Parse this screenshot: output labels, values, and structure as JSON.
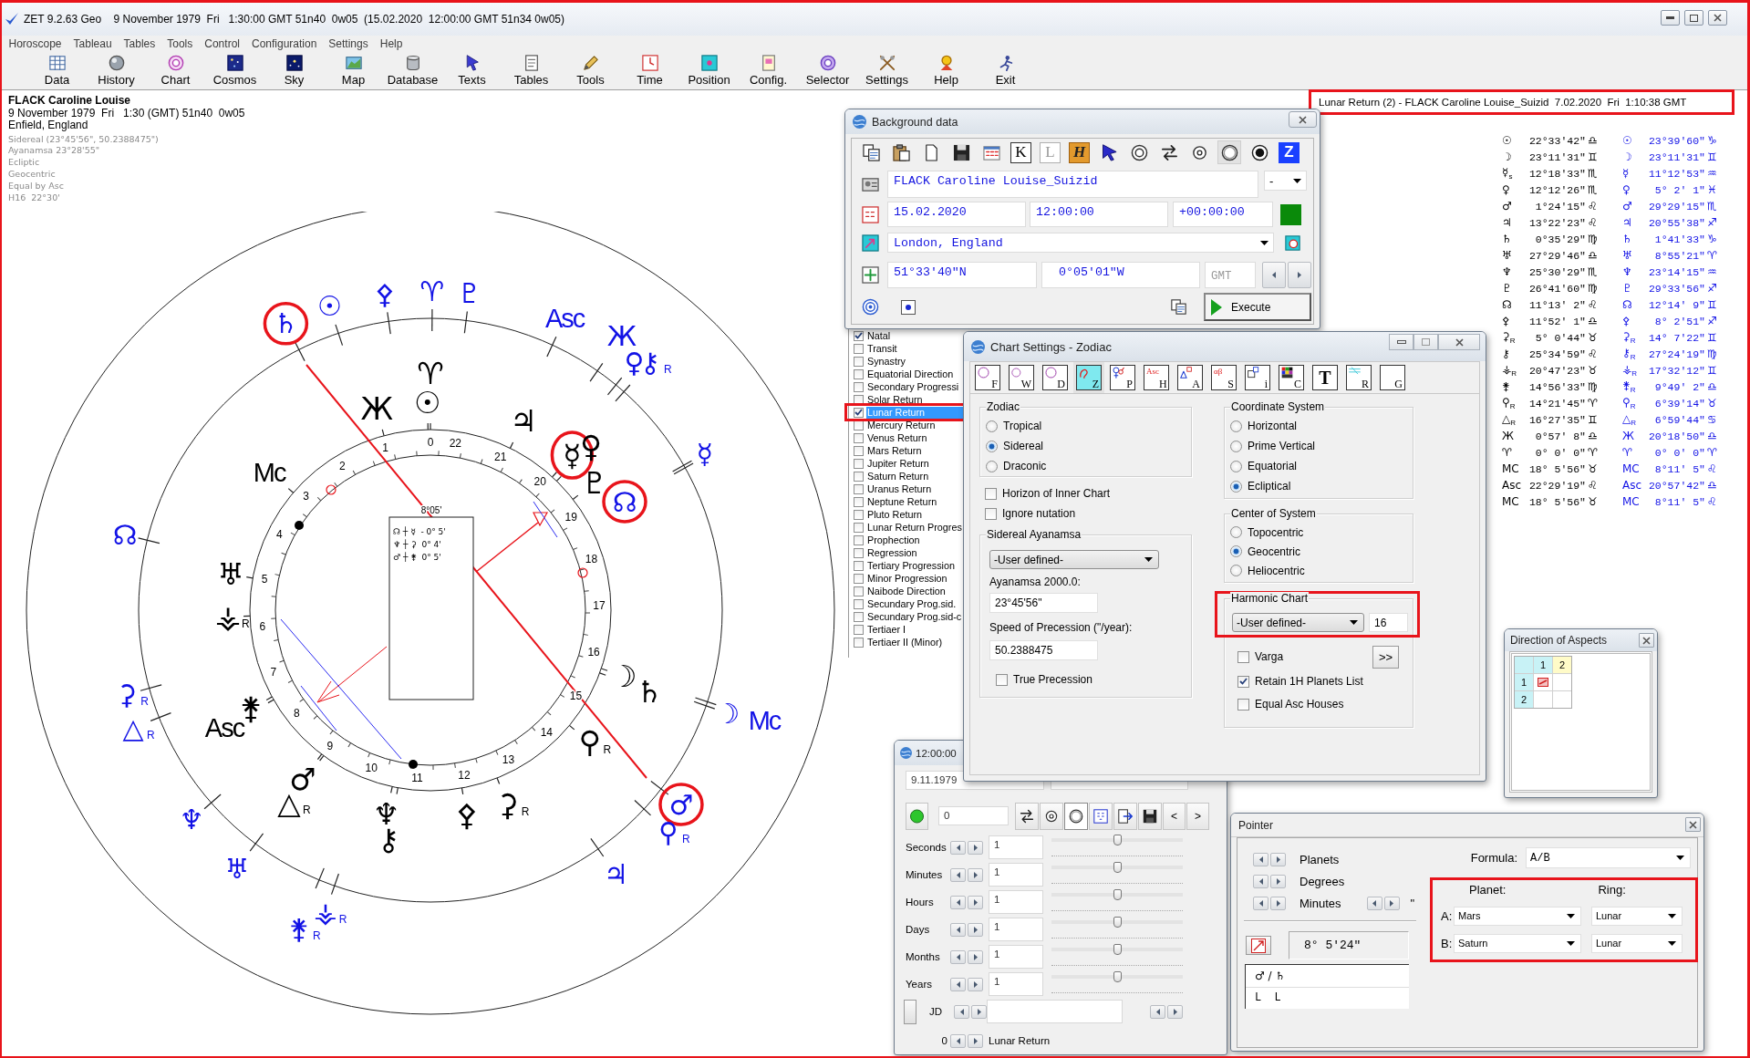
{
  "window": {
    "title": "ZET 9.2.63 Geo    9 November 1979  Fri   1:30:00 GMT 51n40  0w05  (15.02.2020  12:00:00 GMT 51n34 0w05)"
  },
  "menu": [
    "Horoscope",
    "Tableau",
    "Tables",
    "Tools",
    "Control",
    "Configuration",
    "Settings",
    "Help"
  ],
  "toolbar": [
    "Data",
    "History",
    "Chart",
    "Cosmos",
    "Sky",
    "Map",
    "Database",
    "Texts",
    "Tables",
    "Tools",
    "Time",
    "Position",
    "Config.",
    "Selector",
    "Settings",
    "Help",
    "Exit"
  ],
  "chart_header": {
    "name": "FLACK Caroline Louise",
    "lines": [
      "9 November 1979  Fri   1:30 (GMT) 51n40  0w05",
      "Enfield, England"
    ],
    "settings": [
      "Sidereal (23°45'56\", 50.2388475\")",
      "Ayanamsa 23°28'55\"",
      "Ecliptic",
      "Geocentric",
      "Equal by Asc",
      "H16  22°30'"
    ]
  },
  "return_header": {
    "text": "Lunar Return (2) - FLACK Caroline Louise_Suizid  7.02.2020  Fri  1:10:38 GMT",
    "annotated": true
  },
  "wheel": {
    "transit_symbols": [
      {
        "glyph": "♄",
        "kind": "planet",
        "circled": true
      },
      {
        "glyph": "☉",
        "kind": "planet",
        "circled": false
      },
      {
        "glyph": "⚴",
        "kind": "planet",
        "circled": false
      },
      {
        "glyph": "♈",
        "kind": "planet",
        "circled": false
      },
      {
        "glyph": "♇",
        "kind": "planet",
        "circled": false
      },
      {
        "glyph": "Asc",
        "kind": "angle",
        "circled": false
      },
      {
        "glyph": "Ж",
        "kind": "planet",
        "circled": false
      },
      {
        "glyph": "♀",
        "kind": "planet",
        "circled": false
      },
      {
        "glyph": "⚷",
        "kind": "planet",
        "circled": false,
        "retrograde_mark": "R"
      },
      {
        "glyph": "☿",
        "kind": "planet",
        "circled": false
      },
      {
        "glyph": "☊",
        "kind": "planet",
        "circled": true
      },
      {
        "glyph": "☊",
        "kind": "planet",
        "circled": false
      },
      {
        "glyph": "⚳",
        "kind": "planet",
        "circled": false,
        "retrograde_mark": "R"
      },
      {
        "glyph": "△",
        "kind": "planet",
        "circled": false,
        "retrograde_mark": "R"
      },
      {
        "glyph": "☽",
        "kind": "planet",
        "circled": false
      },
      {
        "glyph": "Mc",
        "kind": "angle",
        "circled": false
      },
      {
        "glyph": "♆",
        "kind": "planet",
        "circled": false
      },
      {
        "glyph": "♂",
        "kind": "planet",
        "circled": true
      },
      {
        "glyph": "⚲",
        "kind": "planet",
        "circled": false,
        "retrograde_mark": "R"
      },
      {
        "glyph": "♅",
        "kind": "planet",
        "circled": false
      },
      {
        "glyph": "♃",
        "kind": "planet",
        "circled": false
      },
      {
        "glyph": "⚶",
        "kind": "planet",
        "circled": false,
        "retrograde_mark": "R"
      },
      {
        "glyph": "⚵",
        "kind": "planet",
        "circled": false,
        "retrograde_mark": "R"
      }
    ],
    "natal_symbols": [
      {
        "glyph": "♈",
        "kind": "planet",
        "circled": false
      },
      {
        "glyph": "Ж",
        "kind": "planet",
        "circled": false
      },
      {
        "glyph": "☉",
        "kind": "planet",
        "circled": false
      },
      {
        "glyph": "♃",
        "kind": "planet",
        "circled": false
      },
      {
        "glyph": "☿",
        "kind": "planet",
        "circled": true
      },
      {
        "glyph": "♀",
        "kind": "planet",
        "circled": false
      },
      {
        "glyph": "Mc",
        "kind": "angle",
        "circled": false
      },
      {
        "glyph": "♇",
        "kind": "planet",
        "circled": false
      },
      {
        "glyph": "♅",
        "kind": "planet",
        "circled": false
      },
      {
        "glyph": "⚶",
        "kind": "planet",
        "circled": false,
        "retrograde_mark": "R"
      },
      {
        "glyph": "☽",
        "kind": "planet",
        "circled": false
      },
      {
        "glyph": "⚵",
        "kind": "planet",
        "circled": false
      },
      {
        "glyph": "♄",
        "kind": "planet",
        "circled": false
      },
      {
        "glyph": "Asc",
        "kind": "angle",
        "circled": false
      },
      {
        "glyph": "⚲",
        "kind": "planet",
        "circled": false,
        "retrograde_mark": "R"
      },
      {
        "glyph": "♂",
        "kind": "planet",
        "circled": false
      },
      {
        "glyph": "△",
        "kind": "planet",
        "circled": false,
        "retrograde_mark": "R"
      },
      {
        "glyph": "♆",
        "kind": "planet",
        "circled": false
      },
      {
        "glyph": "⚴",
        "kind": "planet",
        "circled": false
      },
      {
        "glyph": "⚳",
        "kind": "planet",
        "circled": false,
        "retrograde_mark": "R"
      },
      {
        "glyph": "⚷",
        "kind": "planet",
        "circled": false
      }
    ],
    "house_numbers": [
      "1",
      "2",
      "3",
      "4",
      "5",
      "6",
      "7",
      "8",
      "9",
      "10",
      "11",
      "12",
      "13",
      "14",
      "15",
      "16",
      "17",
      "18",
      "19",
      "20",
      "21",
      "22"
    ],
    "zero_mark": "0",
    "center_box": {
      "heading": "8°05'",
      "rows": [
        "☊ ┼ ☿  - 0° 5'",
        "♆ ┼ ⚳  0° 4'",
        "♂ ┼ ⚵  0° 5'"
      ]
    }
  },
  "positions": [
    {
      "natal_glyph": "☉",
      "natal": "22°33'42\"",
      "natal_sign": "♎",
      "transit_glyph": "☉",
      "transit": "23°39'60\"",
      "transit_sign": "♑"
    },
    {
      "natal_glyph": "☽",
      "natal": "23°11'31\"",
      "natal_sign": "♊",
      "transit_glyph": "☽",
      "transit": "23°11'31\"",
      "transit_sign": "♊"
    },
    {
      "natal_glyph": "☿$_{s}$",
      "natal": "12°18'33\"",
      "natal_sign": "♏",
      "transit_glyph": "☿",
      "transit": "11°12'53\"",
      "transit_sign": "♒"
    },
    {
      "natal_glyph": "♀",
      "natal": "12°12'26\"",
      "natal_sign": "♏",
      "transit_glyph": "♀",
      "transit": "5° 2' 1\"",
      "transit_sign": "♓"
    },
    {
      "natal_glyph": "♂",
      "natal": "1°24'15\"",
      "natal_sign": "♌",
      "transit_glyph": "♂",
      "transit": "29°29'15\"",
      "transit_sign": "♏"
    },
    {
      "natal_glyph": "♃",
      "natal": "13°22'23\"",
      "natal_sign": "♌",
      "transit_glyph": "♃",
      "transit": "20°55'38\"",
      "transit_sign": "♐"
    },
    {
      "natal_glyph": "♄",
      "natal": "0°35'29\"",
      "natal_sign": "♍",
      "transit_glyph": "♄",
      "transit": "1°41'33\"",
      "transit_sign": "♑"
    },
    {
      "natal_glyph": "♅",
      "natal": "27°29'46\"",
      "natal_sign": "♎",
      "transit_glyph": "♅",
      "transit": "8°55'21\"",
      "transit_sign": "♈"
    },
    {
      "natal_glyph": "♆",
      "natal": "25°30'29\"",
      "natal_sign": "♏",
      "transit_glyph": "♆",
      "transit": "23°14'15\"",
      "transit_sign": "♒"
    },
    {
      "natal_glyph": "♇",
      "natal": "26°41'60\"",
      "natal_sign": "♍",
      "transit_glyph": "♇",
      "transit": "29°33'56\"",
      "transit_sign": "♐"
    },
    {
      "natal_glyph": "☊",
      "natal": "11°13' 2\"",
      "natal_sign": "♌",
      "transit_glyph": "☊",
      "transit": "12°14' 9\"",
      "transit_sign": "♊"
    },
    {
      "natal_glyph": "⚴",
      "natal": "11°52' 1\"",
      "natal_sign": "♎",
      "transit_glyph": "⚴",
      "transit": "8° 2'51\"",
      "transit_sign": "♐"
    },
    {
      "natal_glyph": "⚳$_{R}$",
      "natal": "5° 0'44\"",
      "natal_sign": "♉",
      "transit_glyph": "⚳$_{R}$",
      "transit": "14° 7'22\"",
      "transit_sign": "♊"
    },
    {
      "natal_glyph": "⚷",
      "natal": "25°34'59\"",
      "natal_sign": "♌",
      "transit_glyph": "⚷$_{R}$",
      "transit": "27°24'19\"",
      "transit_sign": "♍"
    },
    {
      "natal_glyph": "⚶$_{R}$",
      "natal": "20°47'23\"",
      "natal_sign": "♉",
      "transit_glyph": "⚶$_{R}$",
      "transit": "17°32'12\"",
      "transit_sign": "♊"
    },
    {
      "natal_glyph": "⚵",
      "natal": "14°56'33\"",
      "natal_sign": "♍",
      "transit_glyph": "⚵$_{R}$",
      "transit": "9°49' 2\"",
      "transit_sign": "♎"
    },
    {
      "natal_glyph": "⚲$_{R}$",
      "natal": "14°21'45\"",
      "natal_sign": "♈",
      "transit_glyph": "⚲$_{R}$",
      "transit": "6°39'14\"",
      "transit_sign": "♉"
    },
    {
      "natal_glyph": "△$_{R}$",
      "natal": "16°27'35\"",
      "natal_sign": "♊",
      "transit_glyph": "△$_{R}$",
      "transit": "6°59'44\"",
      "transit_sign": "♋"
    },
    {
      "natal_glyph": "Ж",
      "natal": "0°57' 8\"",
      "natal_sign": "♎",
      "transit_glyph": "Ж",
      "transit": "20°18'50\"",
      "transit_sign": "♎"
    },
    {
      "natal_glyph": "♈",
      "natal": "0° 0' 0\"",
      "natal_sign": "♈",
      "transit_glyph": "♈",
      "transit": "0° 0' 0\"",
      "transit_sign": "♈"
    },
    {
      "natal_glyph": "MC",
      "natal": "18° 5'56\"",
      "natal_sign": "♉",
      "transit_glyph": "MC",
      "transit": "8°11' 5\"",
      "transit_sign": "♌"
    },
    {
      "natal_glyph": "Asc",
      "natal": "22°29'19\"",
      "natal_sign": "♌",
      "transit_glyph": "Asc",
      "transit": "20°57'42\"",
      "transit_sign": "♎"
    },
    {
      "natal_glyph": "MC",
      "natal": "18° 5'56\"",
      "natal_sign": "♉",
      "transit_glyph": "MC",
      "transit": "8°11' 5\"",
      "transit_sign": "♌"
    }
  ],
  "background_data": {
    "title": "Background data",
    "tools": [
      {
        "selected": false,
        "disabled": false
      },
      {
        "selected": false,
        "disabled": false
      },
      {
        "selected": false,
        "disabled": false
      },
      {
        "selected": false,
        "disabled": false
      },
      {
        "selected": false,
        "disabled": false
      },
      {
        "letter": "K",
        "selected": false,
        "disabled": false
      },
      {
        "letter": "L",
        "selected": false,
        "disabled": true
      },
      {
        "letter": "H",
        "selected": false,
        "disabled": false
      },
      {
        "selected": false,
        "disabled": false
      },
      {
        "selected": false,
        "disabled": false
      },
      {
        "selected": false,
        "disabled": false
      },
      {
        "selected": false,
        "disabled": false
      },
      {
        "selected": true,
        "disabled": false
      },
      {
        "selected": false,
        "disabled": false
      },
      {
        "letter": "Z",
        "selected": false,
        "disabled": false
      }
    ],
    "name": "FLACK Caroline Louise_Suizid",
    "name_option": "-",
    "date": "15.02.2020",
    "time": "12:00:00",
    "offset": "+00:00:00",
    "place": "London, England",
    "latitude": "51°33'40\"N",
    "longitude": "0°05'01\"W",
    "zone": {
      "placeholder": "GMT"
    },
    "execute": "Execute"
  },
  "horoscope_types": [
    {
      "label": "Natal",
      "checked": true,
      "selected": false,
      "annotated": false
    },
    {
      "label": "Transit",
      "checked": false,
      "selected": false,
      "annotated": false
    },
    {
      "label": "Synastry",
      "checked": false,
      "selected": false,
      "annotated": false
    },
    {
      "label": "Equatorial Direction",
      "checked": false,
      "selected": false,
      "annotated": false
    },
    {
      "label": "Secondary Progressi",
      "checked": false,
      "selected": false,
      "annotated": false
    },
    {
      "label": "Solar Return",
      "checked": false,
      "selected": false,
      "annotated": false
    },
    {
      "label": "Lunar Return",
      "checked": true,
      "selected": true,
      "annotated": true
    },
    {
      "label": "Mercury Return",
      "checked": false,
      "selected": false,
      "annotated": false
    },
    {
      "label": "Venus Return",
      "checked": false,
      "selected": false,
      "annotated": false
    },
    {
      "label": "Mars Return",
      "checked": false,
      "selected": false,
      "annotated": false
    },
    {
      "label": "Jupiter Return",
      "checked": false,
      "selected": false,
      "annotated": false
    },
    {
      "label": "Saturn Return",
      "checked": false,
      "selected": false,
      "annotated": false
    },
    {
      "label": "Uranus Return",
      "checked": false,
      "selected": false,
      "annotated": false
    },
    {
      "label": "Neptune Return",
      "checked": false,
      "selected": false,
      "annotated": false
    },
    {
      "label": "Pluto Return",
      "checked": false,
      "selected": false,
      "annotated": false
    },
    {
      "label": "Lunar Return Progres",
      "checked": false,
      "selected": false,
      "annotated": false
    },
    {
      "label": "Prophection",
      "checked": false,
      "selected": false,
      "annotated": false
    },
    {
      "label": "Regression",
      "checked": false,
      "selected": false,
      "annotated": false
    },
    {
      "label": "Tertiary Progression",
      "checked": false,
      "selected": false,
      "annotated": false
    },
    {
      "label": "Minor Progression",
      "checked": false,
      "selected": false,
      "annotated": false
    },
    {
      "label": "Naibode Direction",
      "checked": false,
      "selected": false,
      "annotated": false
    },
    {
      "label": "Secundary Prog.sid.",
      "checked": false,
      "selected": false,
      "annotated": false
    },
    {
      "label": "Secundary Prog.sid-c",
      "checked": false,
      "selected": false,
      "annotated": false
    },
    {
      "label": "Tertiaer I",
      "checked": false,
      "selected": false,
      "annotated": false
    },
    {
      "label": "Tertiaer II (Minor)",
      "checked": false,
      "selected": false,
      "annotated": false
    }
  ],
  "chart_settings": {
    "title": "Chart Settings - Zodiac",
    "tabs": [
      {
        "kind": "icon",
        "letter": "F",
        "selected": false
      },
      {
        "kind": "icon",
        "letter": "W",
        "selected": false
      },
      {
        "kind": "icon",
        "letter": "D",
        "selected": false
      },
      {
        "kind": "icon",
        "letter": "Z",
        "selected": true
      },
      {
        "kind": "icon",
        "letter": "P",
        "selected": false
      },
      {
        "kind": "icon",
        "letter": "H",
        "caption": "Asc",
        "selected": false
      },
      {
        "kind": "icon",
        "letter": "A",
        "selected": false
      },
      {
        "kind": "icon",
        "letter": "S",
        "caption": "αβ",
        "selected": false
      },
      {
        "kind": "icon",
        "letter": "i",
        "selected": false
      },
      {
        "kind": "icon",
        "letter": "C",
        "selected": false
      },
      {
        "kind": "letter",
        "letter": "T",
        "selected": false
      },
      {
        "kind": "icon",
        "letter": "R",
        "selected": false
      },
      {
        "kind": "icon",
        "letter": "G",
        "selected": false
      }
    ],
    "zodiac": {
      "title": "Zodiac",
      "options": [
        {
          "label": "Tropical",
          "selected": false
        },
        {
          "label": "Sidereal",
          "selected": true
        },
        {
          "label": "Draconic",
          "selected": false
        }
      ]
    },
    "checks": [
      {
        "label": "Horizon of Inner Chart",
        "checked": false
      },
      {
        "label": "Ignore nutation",
        "checked": false
      }
    ],
    "ayanamsa": {
      "title": "Sidereal Ayanamsa",
      "preset": "-User defined-",
      "value_label": "Ayanamsa 2000.0:",
      "value": "23°45'56\"",
      "speed_label": "Speed of Precession (\"/year):",
      "speed": "50.2388475",
      "true_precession": {
        "label": "True Precession",
        "checked": false
      }
    },
    "coordinate_system": {
      "title": "Coordinate System",
      "options": [
        {
          "label": "Horizontal",
          "selected": false
        },
        {
          "label": "Prime Vertical",
          "selected": false
        },
        {
          "label": "Equatorial",
          "selected": false
        },
        {
          "label": "Ecliptical",
          "selected": true
        }
      ]
    },
    "center_of_system": {
      "title": "Center of System",
      "options": [
        {
          "label": "Topocentric",
          "selected": false
        },
        {
          "label": "Geocentric",
          "selected": true
        },
        {
          "label": "Heliocentric",
          "selected": false
        }
      ]
    },
    "harmonic": {
      "title": "Harmonic Chart",
      "preset": "-User defined-",
      "value": "16",
      "annotated": true,
      "more_button": ">>",
      "options": [
        {
          "label": "Varga",
          "checked": false
        },
        {
          "label": "Retain 1H Planets List",
          "checked": true
        },
        {
          "label": "Equal Asc Houses",
          "checked": false
        }
      ]
    }
  },
  "time_panel": {
    "title": "12:00:00",
    "date": "9.11.1979",
    "step": "0",
    "tools": [
      {
        "selected": false
      },
      {
        "selected": false
      },
      {
        "selected": true
      },
      {
        "selected": false
      },
      {
        "selected": false
      },
      {
        "selected": false
      }
    ],
    "prev": "<",
    "next": ">",
    "rows": [
      {
        "label": "Seconds",
        "value": "1",
        "level": 0.5
      },
      {
        "label": "Minutes",
        "value": "1",
        "level": 0.5
      },
      {
        "label": "Hours",
        "value": "1",
        "level": 0.5
      },
      {
        "label": "Days",
        "value": "1",
        "level": 0.5
      },
      {
        "label": "Months",
        "value": "1",
        "level": 0.5
      },
      {
        "label": "Years",
        "value": "1",
        "level": 0.5
      }
    ],
    "jd_label": "JD",
    "counter": "0",
    "counter_label": "Lunar Return"
  },
  "direction_of_aspects": {
    "title": "Direction of Aspects",
    "columns": [
      "1",
      "2"
    ],
    "rows": [
      {
        "label": "1",
        "cells": [
          {
            "marked": true
          },
          {
            "marked": false
          }
        ]
      },
      {
        "label": "2",
        "cells": [
          {
            "marked": false
          },
          {
            "marked": false
          }
        ]
      }
    ]
  },
  "pointer": {
    "title": "Pointer",
    "steps": [
      "Planets",
      "Degrees",
      "Minutes"
    ],
    "seconds_mark": "\"",
    "result": "8° 5'24\"",
    "pair": "♂ / ♄",
    "pair_rings": "L  L",
    "formula_label": "Formula:",
    "formula": "A/B",
    "annotated": true,
    "planet_heading": "Planet:",
    "ring_heading": "Ring:",
    "slots": [
      {
        "label": "A:",
        "planet": "Mars",
        "ring": "Lunar"
      },
      {
        "label": "B:",
        "planet": "Saturn",
        "ring": "Lunar"
      }
    ]
  }
}
